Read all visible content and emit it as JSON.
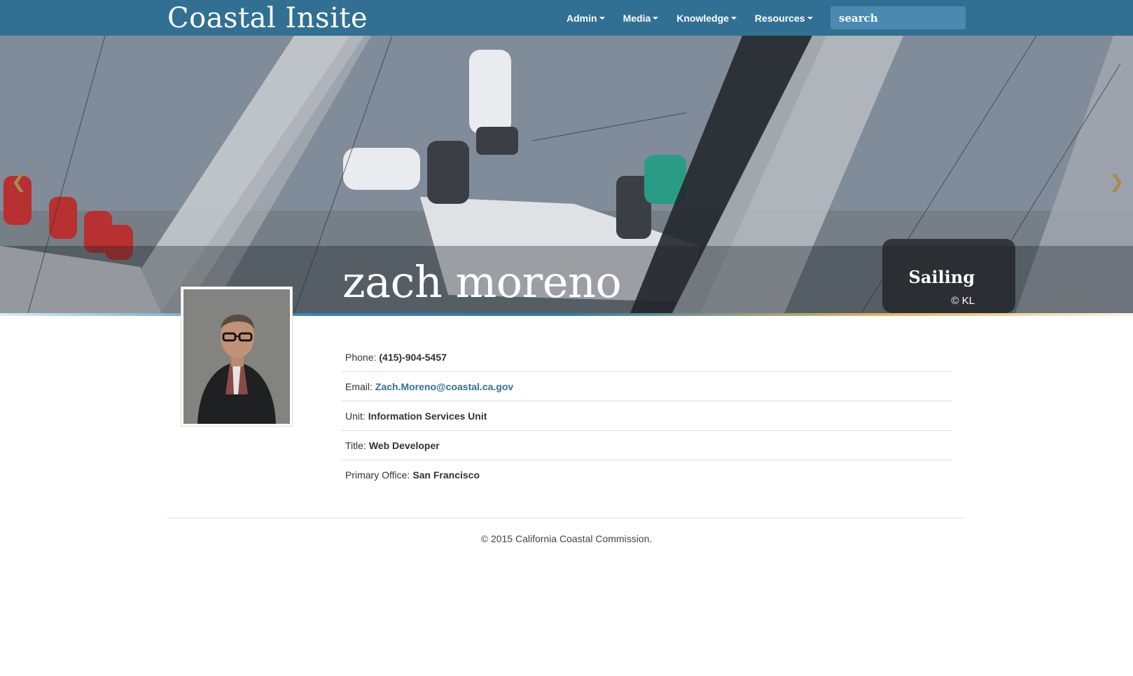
{
  "navbar": {
    "brand": "Coastal Insite",
    "menu": [
      {
        "label": "Admin"
      },
      {
        "label": "Media"
      },
      {
        "label": "Knowledge"
      },
      {
        "label": "Resources"
      }
    ],
    "search": {
      "placeholder": "search"
    },
    "background_color": "#327093"
  },
  "hero": {
    "person_name": "zach moreno",
    "caption_title": "Sailing",
    "caption_credit": "© KL",
    "prev_icon": "chevron-left-icon",
    "next_icon": "chevron-right-icon"
  },
  "profile": {
    "rows": [
      {
        "label": "Phone:",
        "value": "(415)-904-5457"
      },
      {
        "label": "Email:",
        "value": "Zach.Moreno@coastal.ca.gov"
      },
      {
        "label": "Unit:",
        "value": "Information Services Unit"
      },
      {
        "label": "Title:",
        "value": "Web Developer"
      },
      {
        "label": "Primary Office:",
        "value": "San Francisco"
      }
    ],
    "link_color": "#327093"
  },
  "footer": {
    "copyright": "© 2015 California Coastal Commission."
  }
}
